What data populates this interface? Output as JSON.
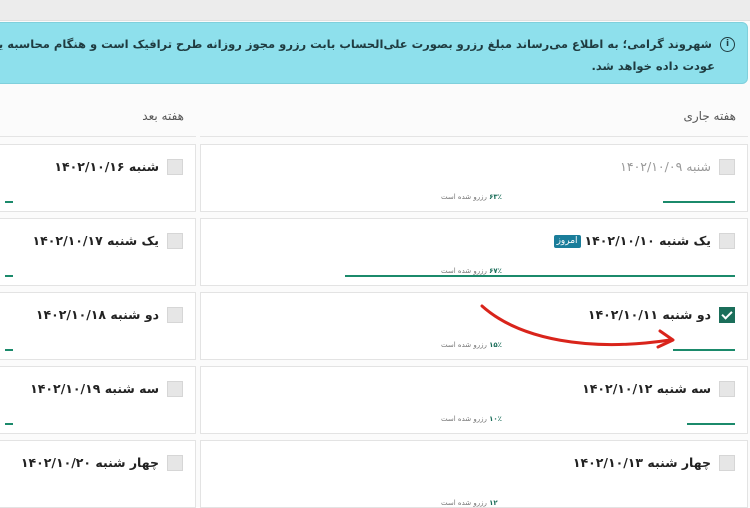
{
  "notice": {
    "line1": "شهروند گرامی؛ به اطلاع می‌رساند مبلغ رزرو بصورت علی‌الحساب بابت رزرو مجوز روزانه طرح ترافیک است و هنگام محاسبه یا در نظر گرفتن",
    "line2": "عودت داده خواهد شد."
  },
  "columns": {
    "current_title": "هفته جاری",
    "next_title": "هفته بعد"
  },
  "current_week": [
    {
      "label": "شنبه ۱۴۰۲/۱۰/۰۹",
      "checked": false,
      "muted": true,
      "reserved_pct": "۶۳٪",
      "reserved_text": "رزرو شده است"
    },
    {
      "label": "یک شنبه ۱۴۰۲/۱۰/۱۰",
      "today_badge": "امروز",
      "checked": false,
      "reserved_pct": "۶۷٪",
      "reserved_text": "رزرو شده است"
    },
    {
      "label": "دو شنبه ۱۴۰۲/۱۰/۱۱",
      "checked": true,
      "reserved_pct": "۱۵٪",
      "reserved_text": "رزرو شده است"
    },
    {
      "label": "سه شنبه ۱۴۰۲/۱۰/۱۲",
      "checked": false,
      "reserved_pct": "۱۰٪",
      "reserved_text": "رزرو شده است"
    },
    {
      "label": "چهار شنبه ۱۴۰۲/۱۰/۱۳",
      "checked": false,
      "reserved_pct": "۱۲",
      "reserved_text": "رزرو شده است"
    }
  ],
  "next_week": [
    {
      "label": "شنبه ۱۴۰۲/۱۰/۱۶"
    },
    {
      "label": "یک شنبه ۱۴۰۲/۱۰/۱۷"
    },
    {
      "label": "دو شنبه ۱۴۰۲/۱۰/۱۸"
    },
    {
      "label": "سه شنبه ۱۴۰۲/۱۰/۱۹"
    },
    {
      "label": "چهار شنبه ۱۴۰۲/۱۰/۲۰"
    }
  ],
  "colors": {
    "accent": "#1b6e5a",
    "notice_bg": "#8ee0ec",
    "annotation_arrow": "#d9241b",
    "badge": "#1a7d9a"
  }
}
